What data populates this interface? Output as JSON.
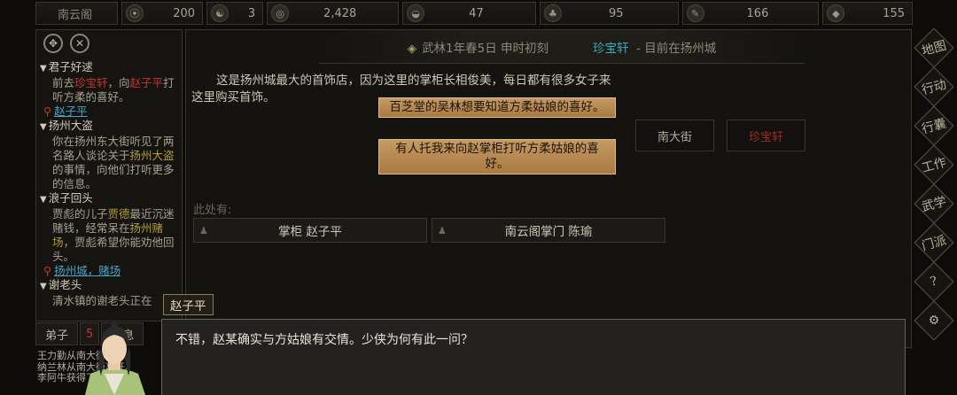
{
  "topbar": {
    "sect": "南云阁",
    "resources": [
      {
        "icon": "reputation-icon",
        "value": "200"
      },
      {
        "icon": "yinyang-icon",
        "value": "3"
      },
      {
        "icon": "coin-icon",
        "value": "2,428"
      },
      {
        "icon": "food-bowl-icon",
        "value": "47"
      },
      {
        "icon": "herb-icon",
        "value": "95"
      },
      {
        "icon": "brush-icon",
        "value": "166"
      },
      {
        "icon": "ore-icon",
        "value": "155"
      }
    ]
  },
  "header": {
    "date": "武林1年春5日 申时初刻",
    "shop": "珍宝轩",
    "location": "-  目前在扬州城"
  },
  "description": "这是扬州城最大的首饰店，因为这里的掌柜长相俊美，每日都有很多女子来这里购买首饰。",
  "choices": [
    "百芝堂的吴林想要知道方柔姑娘的喜好。",
    "有人托我来向赵掌柜打听方柔姑娘的喜好。"
  ],
  "nav": {
    "street": "南大街",
    "current": "珍宝轩"
  },
  "here_label": "此处有:",
  "npcs": [
    "掌柜 赵子平",
    "南云阁掌门 陈瑜"
  ],
  "quests": [
    {
      "title": "君子好逑",
      "body_pre": "前去",
      "body_red1": "珍宝轩",
      "body_mid": "，向",
      "body_red2": "赵子平",
      "body_post": "打听方柔的喜好。",
      "location": "赵子平"
    },
    {
      "title": "扬州大盗",
      "body_pre": "你在扬州东大街听见了两名路人谈论关于",
      "body_gold": "扬州大盗",
      "body_post": "的事情，向他们打听更多的信息。"
    },
    {
      "title": "浪子回头",
      "body_pre": "贾彪的儿子",
      "body_gold1": "贾德",
      "body_mid": "最近沉迷赌钱，经常呆在",
      "body_gold2": "扬州赌场",
      "body_post": "，贾彪希望你能劝他回头。",
      "location": "扬州城，赌场"
    },
    {
      "title": "谢老头",
      "body_pre": "清水镇的谢老头正在"
    }
  ],
  "right_nav": [
    "地图",
    "行动",
    "行囊",
    "工作",
    "武学",
    "门派",
    "?",
    "⚙"
  ],
  "bottom_tabs": [
    "弟子",
    "5",
    "信息"
  ],
  "log_lines": [
    "王力勤从南大街离开。",
    "纳兰林从南大街离开。",
    "李阿牛获得了 本身秘"
  ],
  "dialog": {
    "speaker": "赵子平",
    "text": "不错，赵某确实与方姑娘有交情。少侠为何有此一问？"
  }
}
